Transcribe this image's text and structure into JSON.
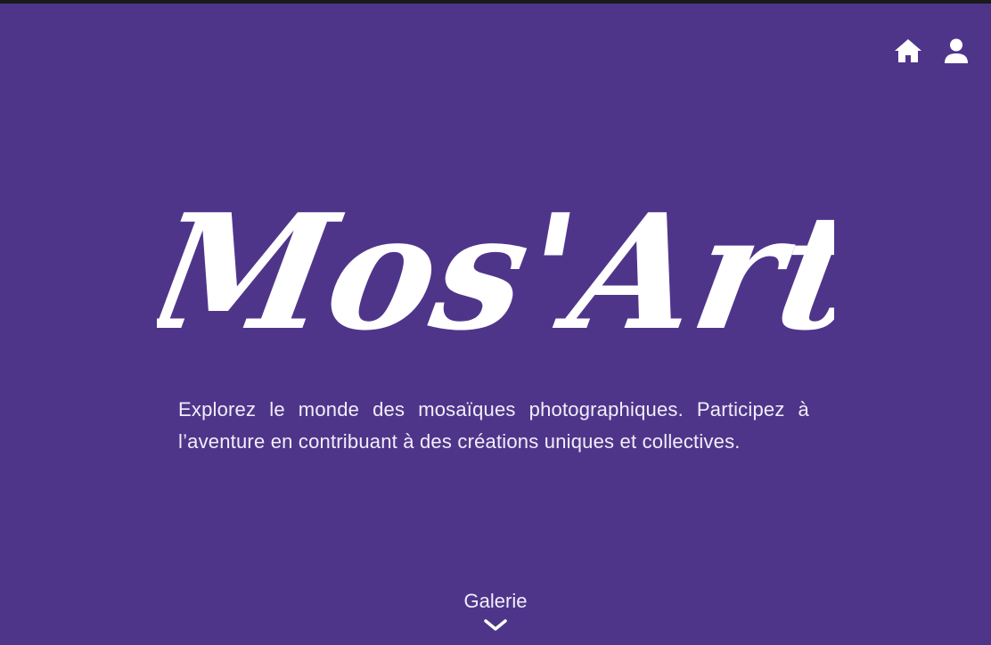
{
  "colors": {
    "background": "#4f358a",
    "foreground": "#ffffff",
    "text": "#f2eefa"
  },
  "header": {
    "icons": [
      "home-icon",
      "user-icon"
    ]
  },
  "hero": {
    "logo_text": "Mos'Art",
    "description": "Explorez le monde des mosaïques photographiques. Participez à l’aventure en contribuant à des créations uniques et collectives."
  },
  "scroll_cta": {
    "label": "Galerie",
    "icon": "chevron-down-icon"
  }
}
